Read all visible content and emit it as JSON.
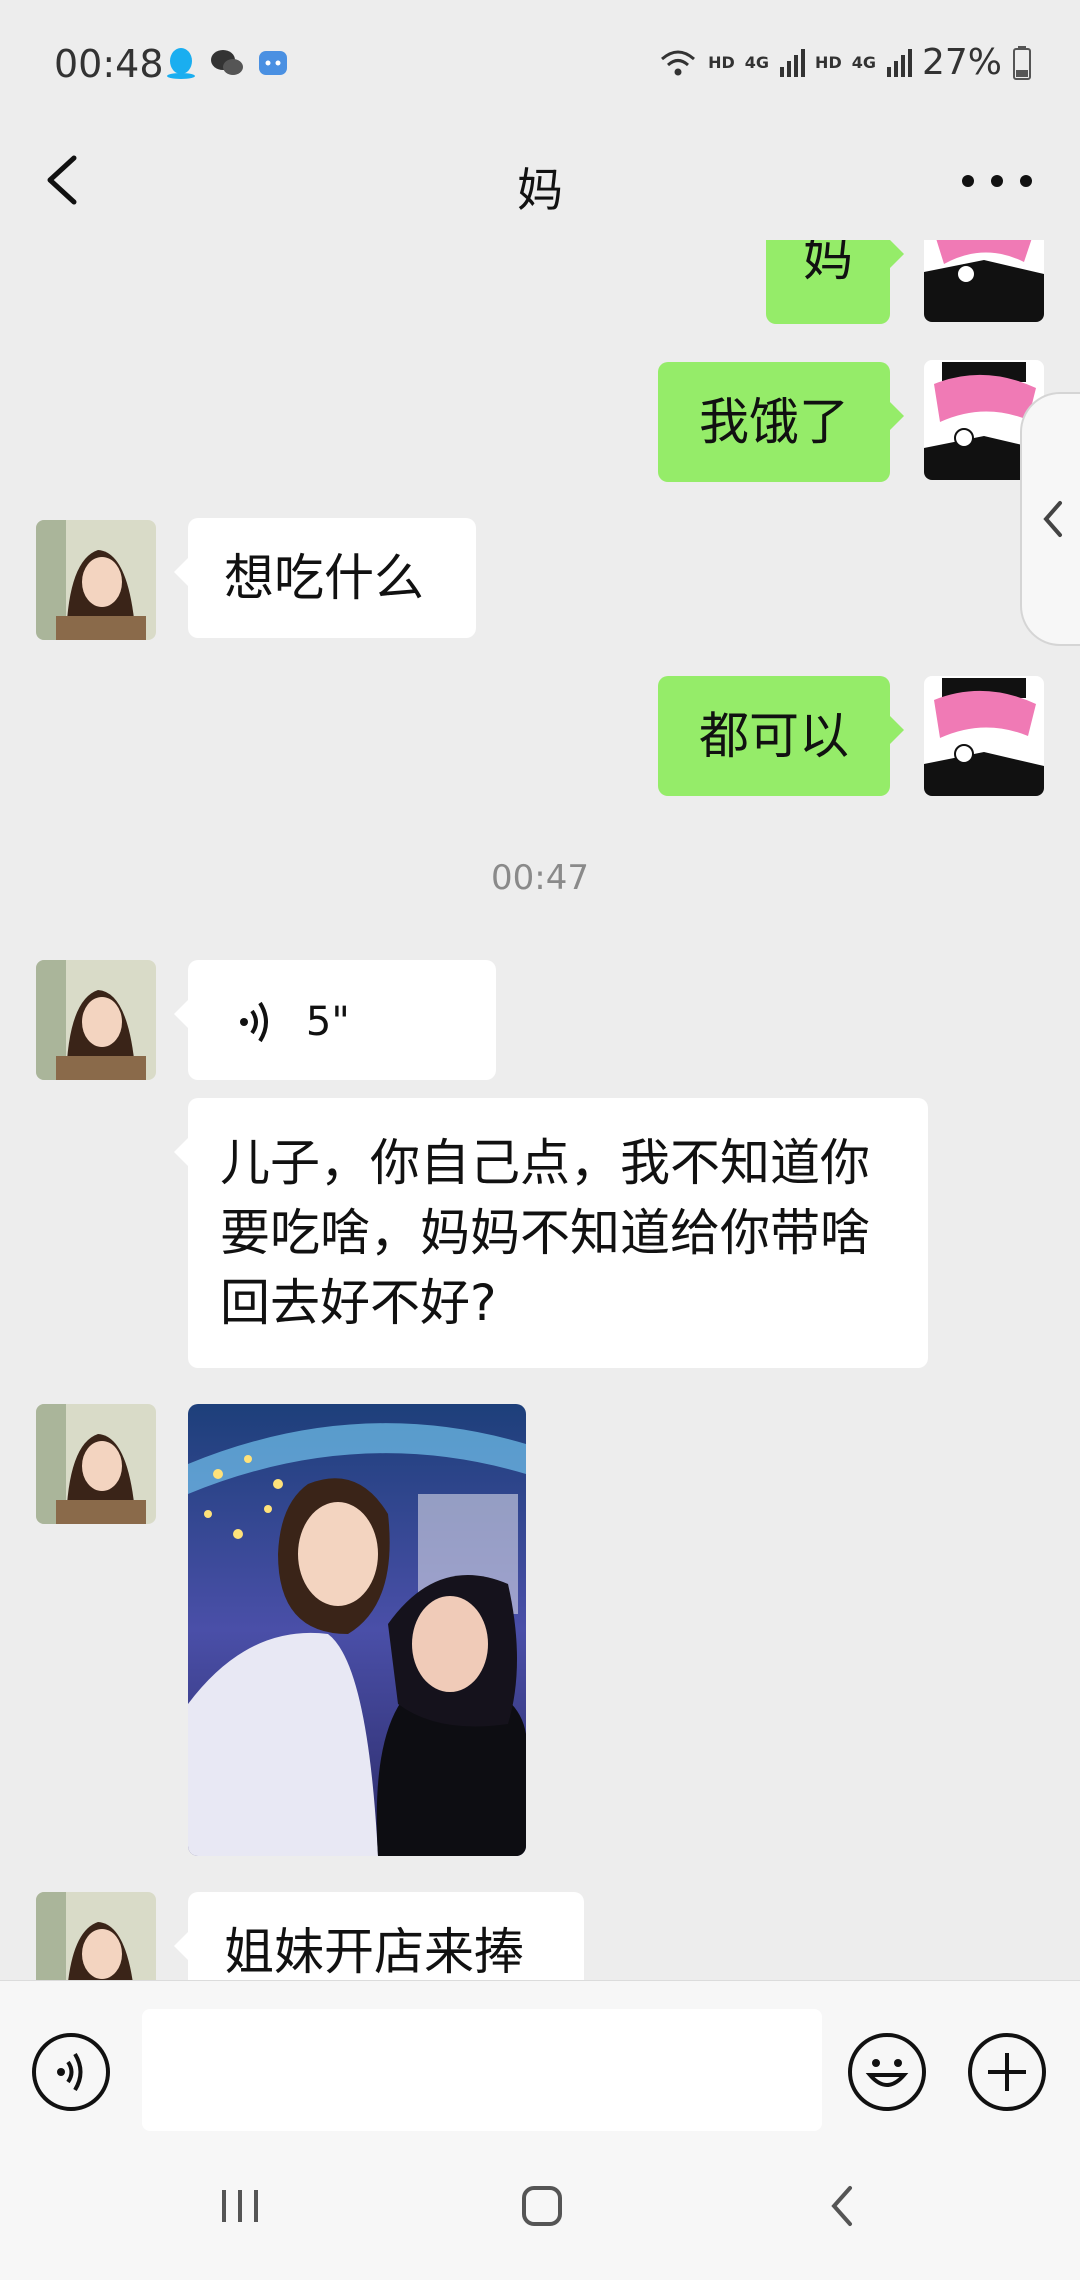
{
  "status_bar": {
    "time": "00:48",
    "net_labels": [
      "HD",
      "4G",
      "HD",
      "4G"
    ],
    "battery": "27%"
  },
  "header": {
    "title": "妈"
  },
  "messages": {
    "m0_text": "妈",
    "m1_text": "我饿了",
    "m2_text": "想吃什么",
    "m3_text": "都可以",
    "timestamp": "00:47",
    "m4_duration": "5\"",
    "m5_text": "儿子，你自己点，我不知道你要吃啥，妈妈不知道给你带啥回去好不好?",
    "m7_text": "姐妹开店来捧"
  },
  "input": {
    "value": ""
  },
  "colors": {
    "green_bubble": "#95ec69",
    "background": "#ededed"
  }
}
